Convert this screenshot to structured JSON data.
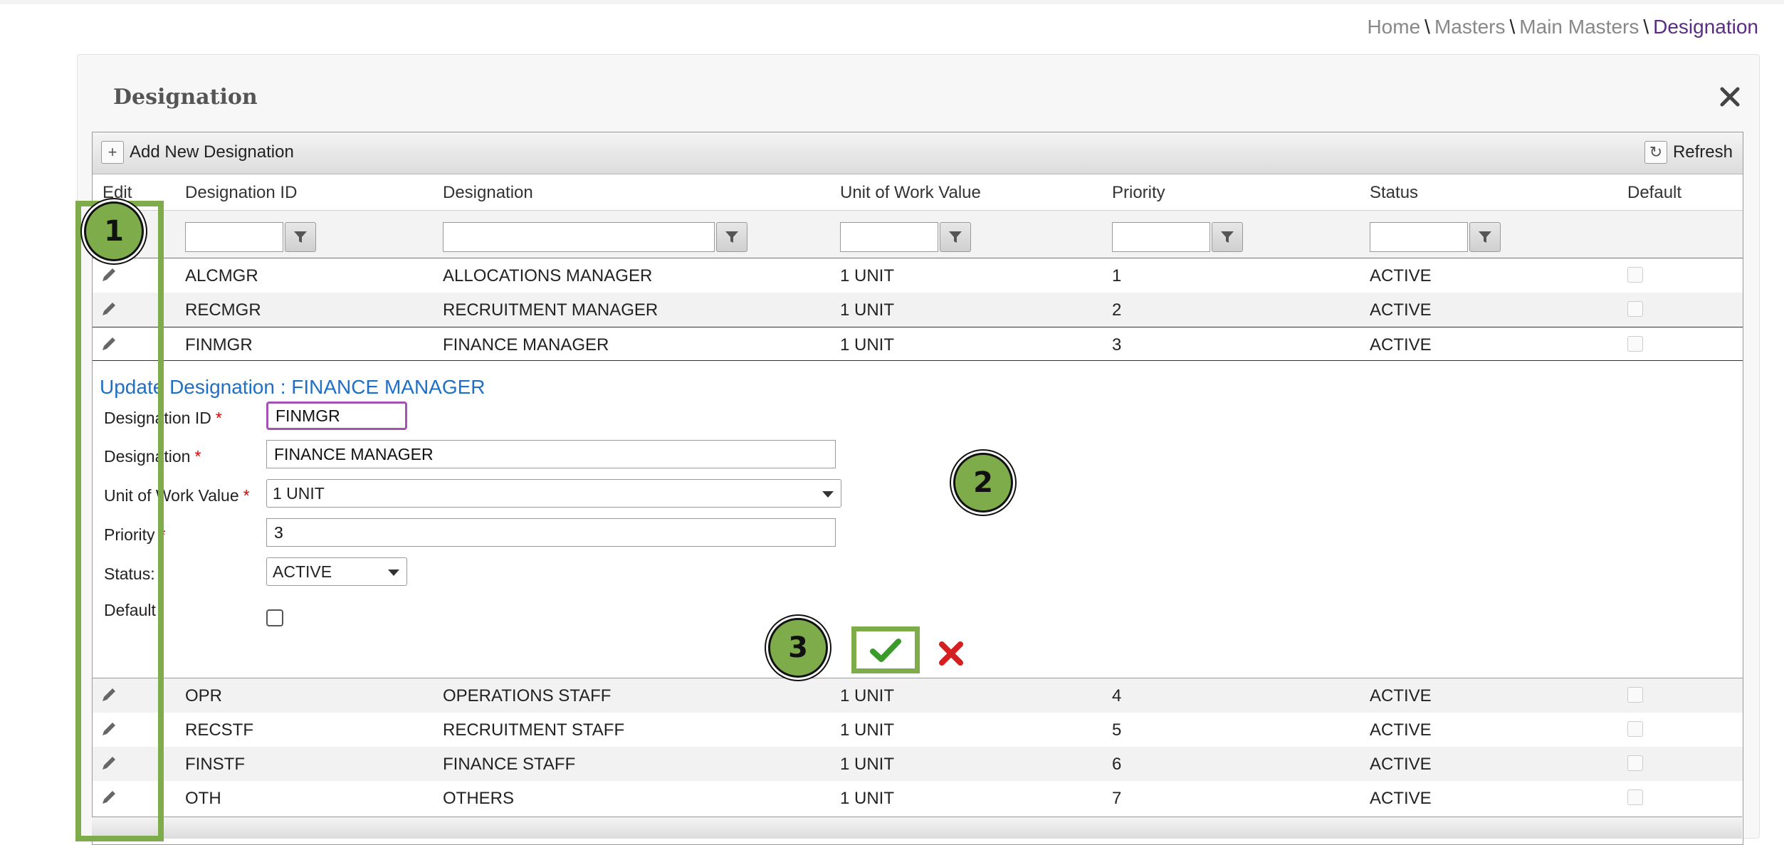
{
  "breadcrumb": {
    "home": "Home",
    "sep": "\\",
    "masters": "Masters",
    "main_masters": "Main Masters",
    "current": "Designation"
  },
  "panel": {
    "title": "Designation"
  },
  "toolbar": {
    "add_label": "Add New Designation",
    "refresh_label": "Refresh"
  },
  "columns": {
    "edit": "Edit",
    "id": "Designation ID",
    "name": "Designation",
    "unit": "Unit of Work Value",
    "priority": "Priority",
    "status": "Status",
    "default": "Default"
  },
  "rows_top": [
    {
      "id": "ALCMGR",
      "name": "ALLOCATIONS MANAGER",
      "unit": "1 UNIT",
      "priority": "1",
      "status": "ACTIVE"
    },
    {
      "id": "RECMGR",
      "name": "RECRUITMENT MANAGER",
      "unit": "1 UNIT",
      "priority": "2",
      "status": "ACTIVE"
    },
    {
      "id": "FINMGR",
      "name": "FINANCE MANAGER",
      "unit": "1 UNIT",
      "priority": "3",
      "status": "ACTIVE"
    }
  ],
  "edit_form": {
    "title": "Update Designation : FINANCE MANAGER",
    "id_label": "Designation ID",
    "id_value": "FINMGR",
    "name_label": "Designation",
    "name_value": "FINANCE MANAGER",
    "unit_label": "Unit of Work Value",
    "unit_value": "1  UNIT",
    "priority_label": "Priority",
    "priority_value": "3",
    "status_label": "Status:",
    "status_value": "ACTIVE",
    "default_label": "Default",
    "required_mark": "*"
  },
  "rows_bottom": [
    {
      "id": "OPR",
      "name": "OPERATIONS STAFF",
      "unit": "1 UNIT",
      "priority": "4",
      "status": "ACTIVE"
    },
    {
      "id": "RECSTF",
      "name": "RECRUITMENT STAFF",
      "unit": "1 UNIT",
      "priority": "5",
      "status": "ACTIVE"
    },
    {
      "id": "FINSTF",
      "name": "FINANCE STAFF",
      "unit": "1 UNIT",
      "priority": "6",
      "status": "ACTIVE"
    },
    {
      "id": "OTH",
      "name": "OTHERS",
      "unit": "1 UNIT",
      "priority": "7",
      "status": "ACTIVE"
    }
  ],
  "annotations": {
    "b1": "1",
    "b2": "2",
    "b3": "3"
  },
  "icons": {
    "add": "plus-icon",
    "refresh": "refresh-icon",
    "close": "close-icon",
    "filter": "filter-icon",
    "edit": "pencil-icon",
    "save": "checkmark-icon",
    "cancel": "x-icon"
  },
  "colors": {
    "accent_green": "#7eac4a",
    "link_blue": "#1f6fc5",
    "breadcrumb_current": "#5a2d82",
    "focus_border": "#a552b5"
  }
}
